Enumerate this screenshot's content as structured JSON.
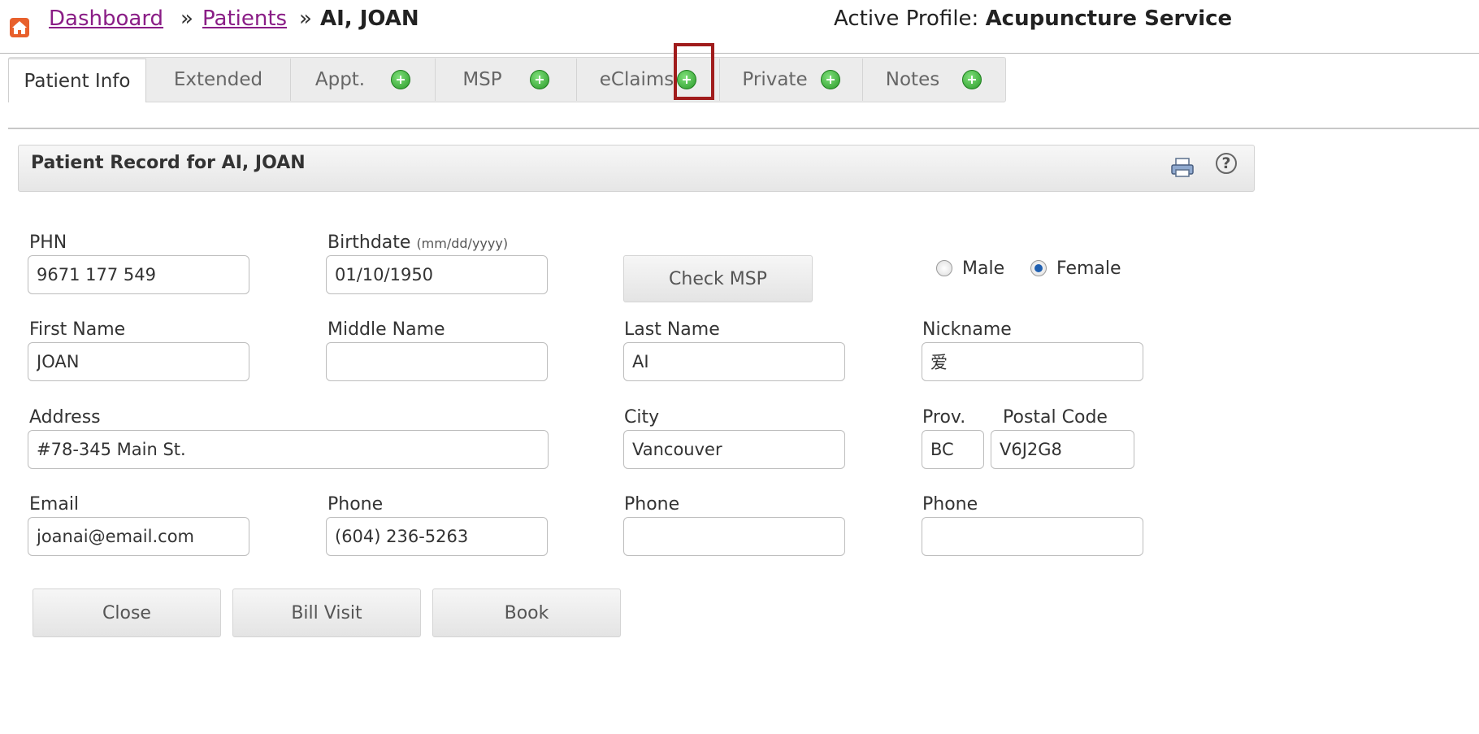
{
  "breadcrumb": {
    "home_icon": "home-icon",
    "dashboard": "Dashboard",
    "sep1": "»",
    "patients": "Patients",
    "sep2": "»",
    "current": "AI, JOAN"
  },
  "active_profile": {
    "label": "Active Profile:",
    "value": "Acupuncture Service"
  },
  "tabs": [
    {
      "label": "Patient Info",
      "active": true,
      "has_add": false
    },
    {
      "label": "Extended",
      "has_add": false
    },
    {
      "label": "Appt.",
      "has_add": true
    },
    {
      "label": "MSP",
      "has_add": true
    },
    {
      "label": "eClaims",
      "has_add": true,
      "highlighted": true
    },
    {
      "label": "Private",
      "has_add": true
    },
    {
      "label": "Notes",
      "has_add": true
    }
  ],
  "record": {
    "title": "Patient Record for AI, JOAN",
    "print_icon": "print-icon",
    "help_icon": "help-icon"
  },
  "form": {
    "phn": {
      "label": "PHN",
      "value": "9671 177 549"
    },
    "birthdate": {
      "label": "Birthdate",
      "hint": "(mm/dd/yyyy)",
      "value": "01/10/1950"
    },
    "check_msp": "Check MSP",
    "gender": {
      "male": "Male",
      "female": "Female",
      "selected": "Female"
    },
    "first_name": {
      "label": "First Name",
      "value": "JOAN"
    },
    "middle_name": {
      "label": "Middle Name",
      "value": ""
    },
    "last_name": {
      "label": "Last Name",
      "value": "AI"
    },
    "nickname": {
      "label": "Nickname",
      "value": "爱"
    },
    "address": {
      "label": "Address",
      "value": "#78-345 Main St."
    },
    "city": {
      "label": "City",
      "value": "Vancouver"
    },
    "prov": {
      "label": "Prov.",
      "value": "BC"
    },
    "postal": {
      "label": "Postal Code",
      "value": "V6J2G8"
    },
    "email": {
      "label": "Email",
      "value": "joanai@email.com"
    },
    "phone1": {
      "label": "Phone",
      "value": "(604) 236-5263"
    },
    "phone2": {
      "label": "Phone",
      "value": ""
    },
    "phone3": {
      "label": "Phone",
      "value": ""
    }
  },
  "actions": {
    "close": "Close",
    "bill_visit": "Bill Visit",
    "book": "Book"
  },
  "colors": {
    "link": "#8a1d86",
    "home": "#e8602c",
    "highlight_box": "#a01c1c",
    "add_green": "#2a9a2a"
  }
}
